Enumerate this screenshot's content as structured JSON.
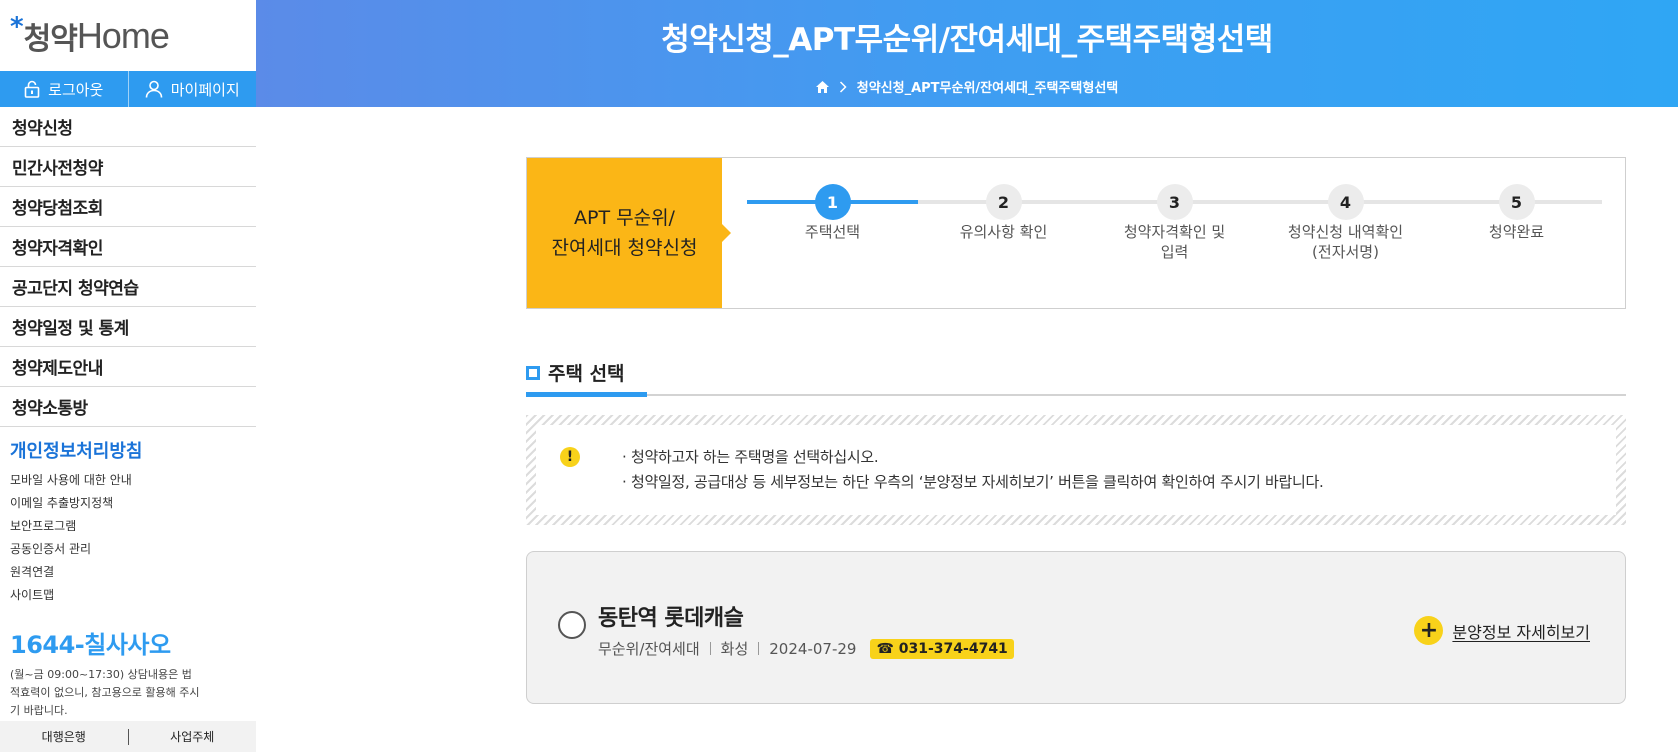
{
  "logo": {
    "ko": "청약",
    "en": "Home"
  },
  "user_bar": {
    "logout": "로그아웃",
    "mypage": "마이페이지"
  },
  "nav": [
    "청약신청",
    "민간사전청약",
    "청약당첨조회",
    "청약자격확인",
    "공고단지 청약연습",
    "청약일정 및 통계",
    "청약제도안내",
    "청약소통방"
  ],
  "privacy": "개인정보처리방침",
  "links": [
    "모바일 사용에 대한 안내",
    "이메일 추출방지정책",
    "보안프로그램",
    "공동인증서 관리",
    "원격연결",
    "사이트맵"
  ],
  "phone": {
    "number": "1644-칠사사오",
    "note": "(월~금 09:00~17:30) 상담내용은 법적효력이 없으니, 참고용으로 활용해 주시기 바랍니다."
  },
  "bottom_tabs": [
    "대행은행",
    "사업주체"
  ],
  "header": {
    "title": "청약신청_APT무순위/잔여세대_주택주택형선택",
    "breadcrumb": "청약신청_APT무순위/잔여세대_주택주택형선택"
  },
  "steps": {
    "label_line1": "APT 무순위/",
    "label_line2": "잔여세대 청약신청",
    "items": [
      {
        "num": "1",
        "line1": "주택선택",
        "line2": ""
      },
      {
        "num": "2",
        "line1": "유의사항 확인",
        "line2": ""
      },
      {
        "num": "3",
        "line1": "청약자격확인 및",
        "line2": "입력"
      },
      {
        "num": "4",
        "line1": "청약신청 내역확인",
        "line2": "(전자서명)"
      },
      {
        "num": "5",
        "line1": "청약완료",
        "line2": ""
      }
    ],
    "active_step": 1
  },
  "section": {
    "title": "주택 선택"
  },
  "notice": [
    "청약하고자 하는 주택명을 선택하십시오.",
    "청약일정, 공급대상 등 세부정보는 하단 우측의 ‘분양정보 자세히보기’ 버튼을 클릭하여 확인하여 주시기 바랍니다."
  ],
  "house": {
    "name": "동탄역 롯데캐슬",
    "type": "무순위/잔여세대",
    "region": "화성",
    "date": "2024-07-29",
    "phone": "☎ 031-374-4741",
    "detail_label": "분양정보 자세히보기"
  },
  "colors": {
    "accent": "#2e9bf0",
    "yellow": "#fbb616",
    "badge": "#f8d21a"
  }
}
